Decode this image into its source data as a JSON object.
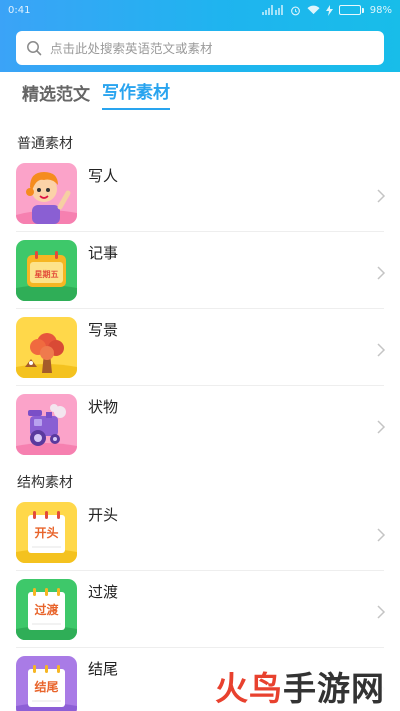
{
  "status_bar": {
    "time": "0:41",
    "battery_percent": 98,
    "battery_label": "98%"
  },
  "search": {
    "placeholder": "点击此处搜索英语范文或素材"
  },
  "tabs": [
    {
      "label": "精选范文",
      "active": false
    },
    {
      "label": "写作素材",
      "active": true
    }
  ],
  "sections": [
    {
      "title": "普通素材",
      "items": [
        {
          "label": "写人",
          "icon": "girl-avatar-icon"
        },
        {
          "label": "记事",
          "icon": "calendar-icon",
          "icon_text": "星期五"
        },
        {
          "label": "写景",
          "icon": "tree-scenery-icon"
        },
        {
          "label": "状物",
          "icon": "toy-train-icon"
        }
      ]
    },
    {
      "title": "结构素材",
      "items": [
        {
          "label": "开头",
          "icon": "note-icon",
          "icon_text": "开头"
        },
        {
          "label": "过渡",
          "icon": "note-icon",
          "icon_text": "过渡"
        },
        {
          "label": "结尾",
          "icon": "note-icon",
          "icon_text": "结尾"
        }
      ]
    }
  ],
  "watermark": {
    "part1": "火鸟",
    "part2": "手游网"
  },
  "colors": {
    "accent": "#29a4ef",
    "header_start": "#3ba3f7",
    "header_end": "#18bde9"
  }
}
